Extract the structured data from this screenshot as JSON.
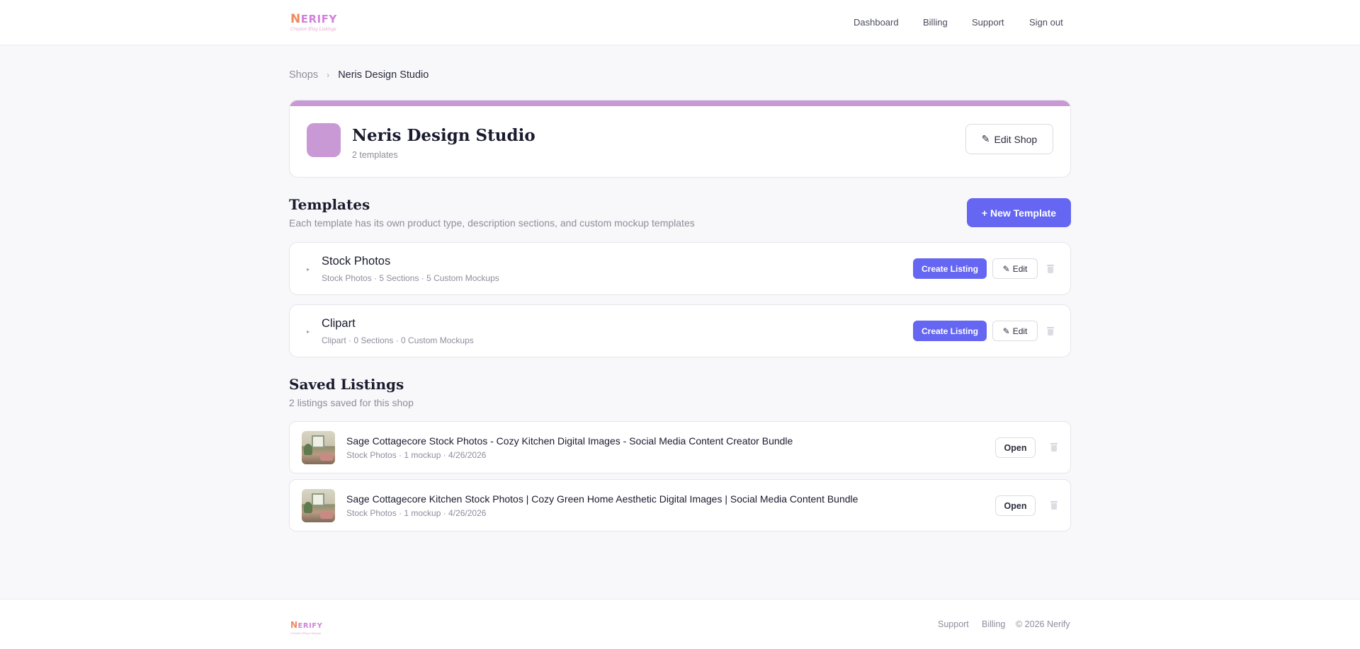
{
  "header": {
    "logo": {
      "initial": "N",
      "rest": "ERIFY",
      "tagline": "Creator Etsy Listings"
    },
    "nav": [
      "Dashboard",
      "Billing",
      "Support",
      "Sign out"
    ]
  },
  "breadcrumb": {
    "root": "Shops",
    "separator": "›",
    "current": "Neris Design Studio"
  },
  "shop": {
    "name": "Neris Design Studio",
    "subtitle": "2 templates",
    "edit_icon": "✎",
    "edit_label": "Edit Shop",
    "accent_color": "#c999d6"
  },
  "templates_section": {
    "title": "Templates",
    "subtitle": "Each template has its own product type, description sections, and custom mockup templates",
    "new_button": "+ New Template",
    "items": [
      {
        "caret": "▸",
        "name": "Stock Photos",
        "meta": "Stock Photos · 5 Sections · 5 Custom Mockups",
        "create_label": "Create Listing",
        "edit_icon": "✎",
        "edit_label": "Edit"
      },
      {
        "caret": "▸",
        "name": "Clipart",
        "meta": "Clipart · 0 Sections · 0 Custom Mockups",
        "create_label": "Create Listing",
        "edit_icon": "✎",
        "edit_label": "Edit"
      }
    ]
  },
  "listings_section": {
    "title": "Saved Listings",
    "subtitle": "2 listings saved for this shop",
    "items": [
      {
        "title": "Sage Cottagecore Stock Photos - Cozy Kitchen Digital Images - Social Media Content Creator Bundle",
        "meta": "Stock Photos · 1 mockup · 4/26/2026",
        "open_label": "Open"
      },
      {
        "title": "Sage Cottagecore Kitchen Stock Photos | Cozy Green Home Aesthetic Digital Images | Social Media Content Bundle",
        "meta": "Stock Photos · 1 mockup · 4/26/2026",
        "open_label": "Open"
      }
    ]
  },
  "footer": {
    "logo": {
      "initial": "N",
      "rest": "ERIFY",
      "tagline": "Creator Etsy Listings"
    },
    "links": [
      "Support",
      "Billing"
    ],
    "copyright": "© 2026 Nerify"
  },
  "colors": {
    "primary": "#6566f1",
    "brand_pink": "#d183d9",
    "brand_orange": "#f08a5d"
  }
}
